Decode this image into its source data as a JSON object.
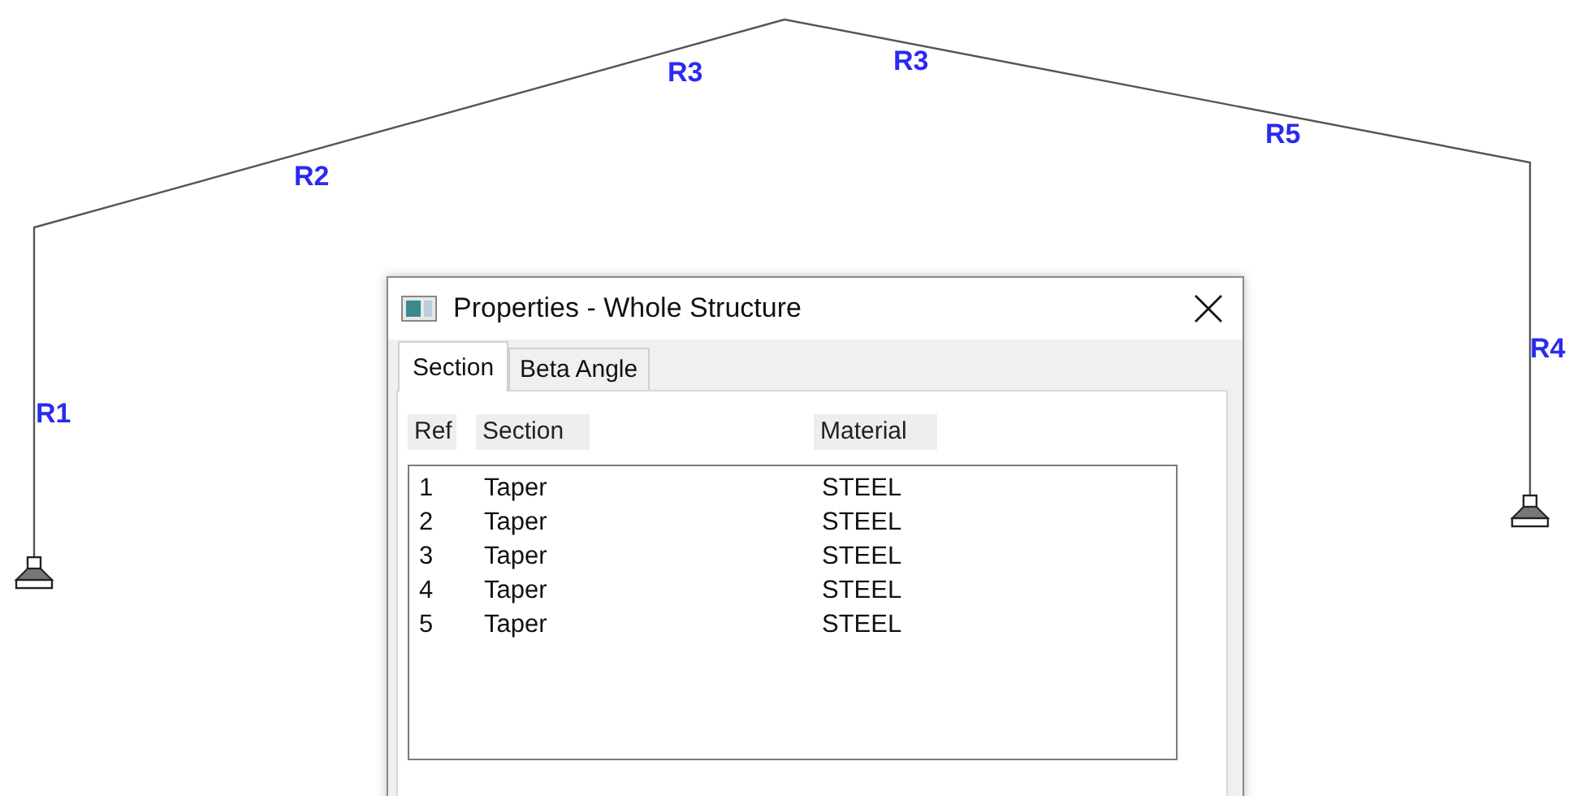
{
  "diagram": {
    "member_labels": [
      "R1",
      "R2",
      "R3",
      "R3",
      "R5",
      "R4"
    ]
  },
  "dialog": {
    "title": "Properties - Whole Structure",
    "tabs": [
      {
        "label": "Section",
        "selected": true
      },
      {
        "label": "Beta Angle",
        "selected": false
      }
    ],
    "table": {
      "columns": [
        "Ref",
        "Section",
        "Material"
      ],
      "rows": [
        [
          "1",
          "Taper",
          "STEEL"
        ],
        [
          "2",
          "Taper",
          "STEEL"
        ],
        [
          "3",
          "Taper",
          "STEEL"
        ],
        [
          "4",
          "Taper",
          "STEEL"
        ],
        [
          "5",
          "Taper",
          "STEEL"
        ]
      ]
    }
  }
}
